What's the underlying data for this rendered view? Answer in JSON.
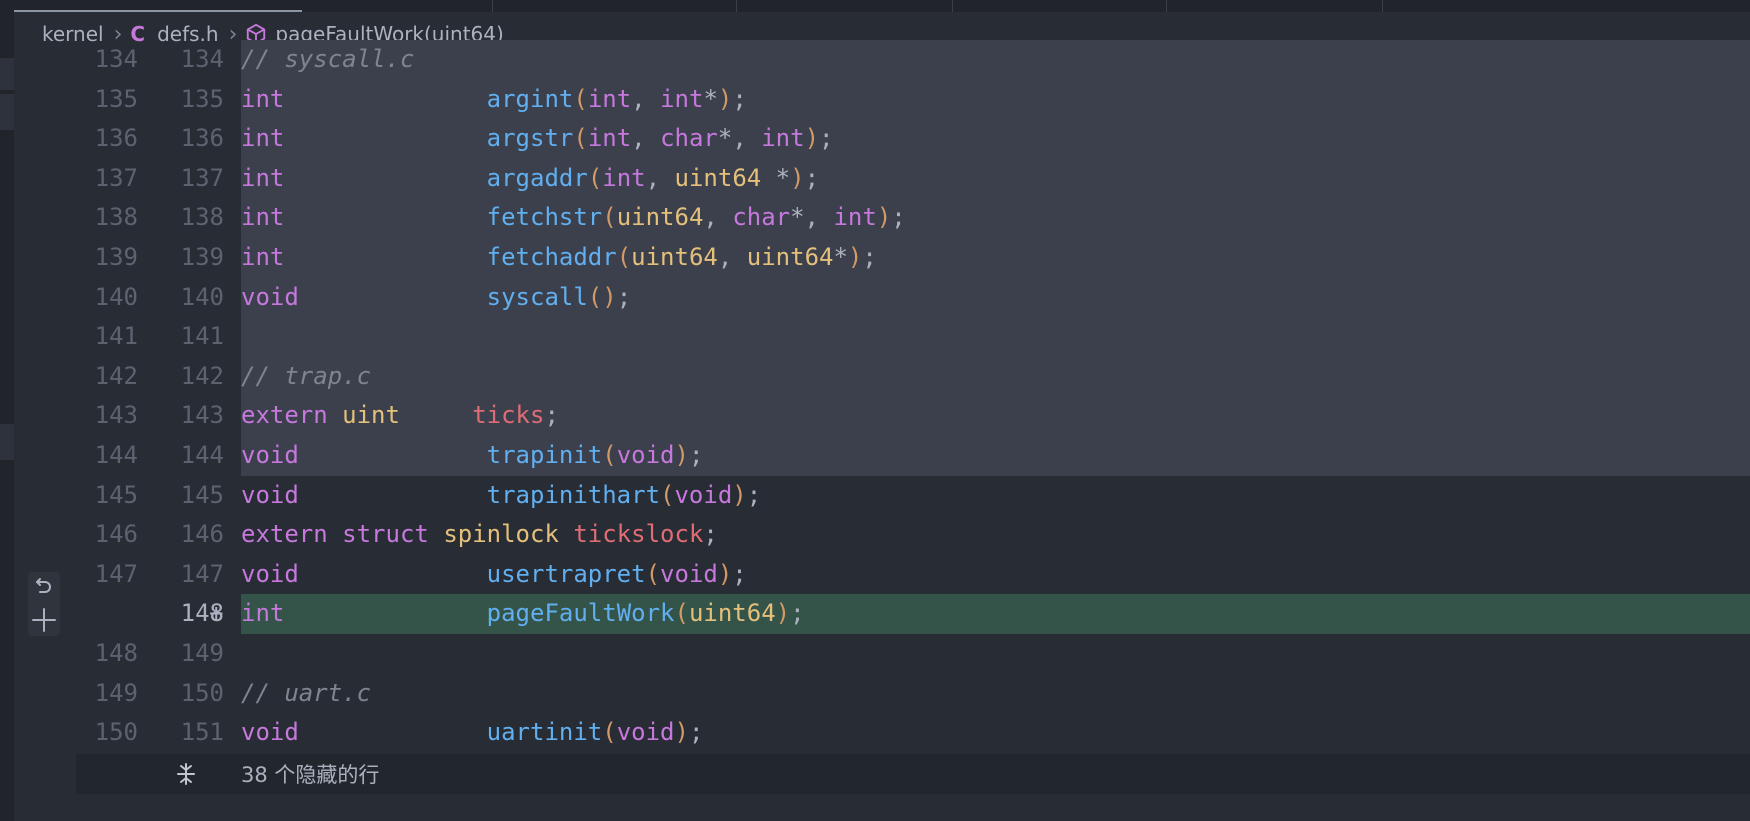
{
  "breadcrumb": {
    "folder": "kernel",
    "file_icon": "C",
    "file": "defs.h",
    "symbol": "pageFaultWork(uint64)"
  },
  "lines": [
    {
      "old": "134",
      "new": "134",
      "kind": "sel",
      "tokens": [
        [
          "cm",
          "// syscall.c"
        ]
      ]
    },
    {
      "old": "135",
      "new": "135",
      "kind": "sel",
      "tokens": [
        [
          "kw",
          "int"
        ],
        [
          "pc",
          "              "
        ],
        [
          "fn",
          "argint"
        ],
        [
          "pa",
          "("
        ],
        [
          "kw",
          "int"
        ],
        [
          "pc",
          ", "
        ],
        [
          "kw",
          "int"
        ],
        [
          "pc",
          "*"
        ],
        [
          "pa",
          ")"
        ],
        [
          "pc",
          ";"
        ]
      ]
    },
    {
      "old": "136",
      "new": "136",
      "kind": "sel",
      "tokens": [
        [
          "kw",
          "int"
        ],
        [
          "pc",
          "              "
        ],
        [
          "fn",
          "argstr"
        ],
        [
          "pa",
          "("
        ],
        [
          "kw",
          "int"
        ],
        [
          "pc",
          ", "
        ],
        [
          "kw",
          "char"
        ],
        [
          "pc",
          "*, "
        ],
        [
          "kw",
          "int"
        ],
        [
          "pa",
          ")"
        ],
        [
          "pc",
          ";"
        ]
      ]
    },
    {
      "old": "137",
      "new": "137",
      "kind": "sel",
      "tokens": [
        [
          "kw",
          "int"
        ],
        [
          "pc",
          "              "
        ],
        [
          "fn",
          "argaddr"
        ],
        [
          "pa",
          "("
        ],
        [
          "kw",
          "int"
        ],
        [
          "pc",
          ", "
        ],
        [
          "ty",
          "uint64"
        ],
        [
          "pc",
          " *"
        ],
        [
          "pa",
          ")"
        ],
        [
          "pc",
          ";"
        ]
      ]
    },
    {
      "old": "138",
      "new": "138",
      "kind": "sel",
      "tokens": [
        [
          "kw",
          "int"
        ],
        [
          "pc",
          "              "
        ],
        [
          "fn",
          "fetchstr"
        ],
        [
          "pa",
          "("
        ],
        [
          "ty",
          "uint64"
        ],
        [
          "pc",
          ", "
        ],
        [
          "kw",
          "char"
        ],
        [
          "pc",
          "*, "
        ],
        [
          "kw",
          "int"
        ],
        [
          "pa",
          ")"
        ],
        [
          "pc",
          ";"
        ]
      ]
    },
    {
      "old": "139",
      "new": "139",
      "kind": "sel",
      "tokens": [
        [
          "kw",
          "int"
        ],
        [
          "pc",
          "              "
        ],
        [
          "fn",
          "fetchaddr"
        ],
        [
          "pa",
          "("
        ],
        [
          "ty",
          "uint64"
        ],
        [
          "pc",
          ", "
        ],
        [
          "ty",
          "uint64"
        ],
        [
          "pc",
          "*"
        ],
        [
          "pa",
          ")"
        ],
        [
          "pc",
          ";"
        ]
      ]
    },
    {
      "old": "140",
      "new": "140",
      "kind": "sel",
      "tokens": [
        [
          "kw",
          "void"
        ],
        [
          "pc",
          "             "
        ],
        [
          "fn",
          "syscall"
        ],
        [
          "pa",
          "()"
        ],
        [
          "pc",
          ";"
        ]
      ]
    },
    {
      "old": "141",
      "new": "141",
      "kind": "sel",
      "tokens": []
    },
    {
      "old": "142",
      "new": "142",
      "kind": "sel",
      "tokens": [
        [
          "cm",
          "// trap.c"
        ]
      ]
    },
    {
      "old": "143",
      "new": "143",
      "kind": "sel",
      "tokens": [
        [
          "kw",
          "extern"
        ],
        [
          "pc",
          " "
        ],
        [
          "ty",
          "uint"
        ],
        [
          "pc",
          "     "
        ],
        [
          "va",
          "ticks"
        ],
        [
          "pc",
          ";"
        ]
      ]
    },
    {
      "old": "144",
      "new": "144",
      "kind": "sel",
      "tokens": [
        [
          "kw",
          "void"
        ],
        [
          "pc",
          "             "
        ],
        [
          "fn",
          "trapinit"
        ],
        [
          "pa",
          "("
        ],
        [
          "kw",
          "void"
        ],
        [
          "pa",
          ")"
        ],
        [
          "pc",
          ";"
        ]
      ]
    },
    {
      "old": "145",
      "new": "145",
      "kind": "normal",
      "tokens": [
        [
          "kw",
          "void"
        ],
        [
          "pc",
          "             "
        ],
        [
          "fn",
          "trapinithart"
        ],
        [
          "pa",
          "("
        ],
        [
          "kw",
          "void"
        ],
        [
          "pa",
          ")"
        ],
        [
          "pc",
          ";"
        ]
      ]
    },
    {
      "old": "146",
      "new": "146",
      "kind": "normal",
      "tokens": [
        [
          "kw",
          "extern"
        ],
        [
          "pc",
          " "
        ],
        [
          "kw",
          "struct"
        ],
        [
          "pc",
          " "
        ],
        [
          "ty",
          "spinlock"
        ],
        [
          "pc",
          " "
        ],
        [
          "va",
          "tickslock"
        ],
        [
          "pc",
          ";"
        ]
      ]
    },
    {
      "old": "147",
      "new": "147",
      "kind": "normal",
      "tokens": [
        [
          "kw",
          "void"
        ],
        [
          "pc",
          "             "
        ],
        [
          "fn",
          "usertrapret"
        ],
        [
          "pa",
          "("
        ],
        [
          "kw",
          "void"
        ],
        [
          "pa",
          ")"
        ],
        [
          "pc",
          ";"
        ]
      ]
    },
    {
      "old": "",
      "new": "148",
      "kind": "added",
      "marker": "+",
      "tokens": [
        [
          "kw",
          "int"
        ],
        [
          "pc",
          "              "
        ],
        [
          "fn",
          "pageFaultWork"
        ],
        [
          "pa",
          "("
        ],
        [
          "ty",
          "uint64"
        ],
        [
          "pa",
          ")"
        ],
        [
          "pc",
          ";"
        ]
      ]
    },
    {
      "old": "148",
      "new": "149",
      "kind": "normal",
      "tokens": []
    },
    {
      "old": "149",
      "new": "150",
      "kind": "normal",
      "tokens": [
        [
          "cm",
          "// uart.c"
        ]
      ]
    },
    {
      "old": "150",
      "new": "151",
      "kind": "normal",
      "tokens": [
        [
          "kw",
          "void"
        ],
        [
          "pc",
          "             "
        ],
        [
          "fn",
          "uartinit"
        ],
        [
          "pa",
          "("
        ],
        [
          "kw",
          "void"
        ],
        [
          "pa",
          ")"
        ],
        [
          "pc",
          ";"
        ]
      ]
    }
  ],
  "hidden_lines": {
    "label": "38 个隐藏的行"
  },
  "icons": {
    "revert": "revert-icon",
    "stage": "plus-icon",
    "unfold": "unfold-icon",
    "symbol": "cube-icon"
  },
  "colors": {
    "keyword": "#c678dd",
    "function": "#61afef",
    "type": "#e5c07b",
    "variable": "#e06c75",
    "comment": "#7f848e",
    "added_bg": "#34544a",
    "selection_bg": "#3b404c"
  }
}
